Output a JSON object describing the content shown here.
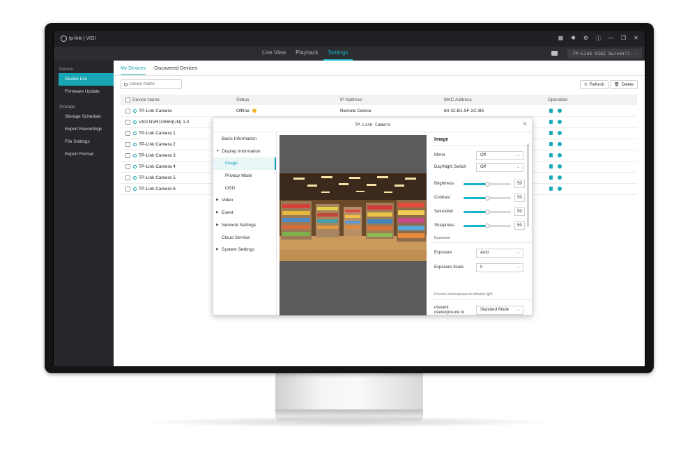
{
  "app": {
    "logo_text": "tp-link | VIGI",
    "nav_tabs": [
      {
        "label": "Live View"
      },
      {
        "label": "Playback"
      },
      {
        "label": "Settings"
      }
    ],
    "nvr_select": "TP-Link VIGI Surveill···"
  },
  "sidebar": {
    "groups": [
      {
        "title": "Device",
        "items": [
          {
            "label": "Device List"
          },
          {
            "label": "Firmware Update"
          }
        ]
      },
      {
        "title": "Storage",
        "items": [
          {
            "label": "Storage Schedule"
          },
          {
            "label": "Export Recordings"
          },
          {
            "label": "File Settings"
          },
          {
            "label": "Export Format"
          }
        ]
      }
    ]
  },
  "main": {
    "subtabs": [
      {
        "label": "My Devices"
      },
      {
        "label": "Discovered Devices"
      }
    ],
    "search_placeholder": "Device Name",
    "refresh_label": "Refresh",
    "delete_label": "Delete",
    "columns": [
      "Device Name",
      "Status",
      "IP Address",
      "MAC Address",
      "Operation"
    ],
    "rows": [
      {
        "name": "TP-Link Camera",
        "status": "Offline",
        "ip": "Remote Device",
        "mac": "60-32-B1-5F-2C-B5"
      },
      {
        "name": "VIGI NVR1008H(UN) 1.0",
        "status": "",
        "ip": "",
        "mac": ""
      },
      {
        "name": "TP-Link Camera  1",
        "status": "",
        "ip": "",
        "mac": ""
      },
      {
        "name": "TP-Link Camera  2",
        "status": "",
        "ip": "",
        "mac": ""
      },
      {
        "name": "TP-Link Camera  3",
        "status": "",
        "ip": "",
        "mac": ""
      },
      {
        "name": "TP-Link Camera  4",
        "status": "",
        "ip": "",
        "mac": ""
      },
      {
        "name": "TP-Link Camera  5",
        "status": "",
        "ip": "",
        "mac": ""
      },
      {
        "name": "TP-Link Camera  6",
        "status": "",
        "ip": "",
        "mac": ""
      }
    ]
  },
  "dialog": {
    "title": "TP-Link Camera",
    "nav": [
      {
        "label": "Basic Information"
      },
      {
        "label": "Display Information"
      },
      {
        "label": "Image"
      },
      {
        "label": "Privacy Mask"
      },
      {
        "label": "OSD"
      },
      {
        "label": "Video"
      },
      {
        "label": "Event"
      },
      {
        "label": "Network Settings"
      },
      {
        "label": "Cloud Service"
      },
      {
        "label": "System Settings"
      }
    ],
    "panel": {
      "title": "Image",
      "mirror_label": "Mirror",
      "mirror_value": "Off",
      "daynight_label": "Day/Night Switch",
      "daynight_value": "Off",
      "sliders": [
        {
          "label": "Brightness",
          "value": 50
        },
        {
          "label": "Contrast",
          "value": 50
        },
        {
          "label": "Saturation",
          "value": 50
        },
        {
          "label": "Sharpness",
          "value": 50
        }
      ],
      "exposure_section": "Exposure",
      "exposure_label": "Exposure",
      "exposure_value": "Auto",
      "exposure_scale_label": "Exposure Scale",
      "exposure_scale_value": "0",
      "hint": "Prevent overexposure to infrared light",
      "prevent_label": "Prevent overexposure to infrared light",
      "prevent_value": "Standard Mode"
    }
  },
  "colors": {
    "accent": "#18a6b6",
    "offline": "#f1b52a",
    "sidebar_bg": "#25272a"
  }
}
